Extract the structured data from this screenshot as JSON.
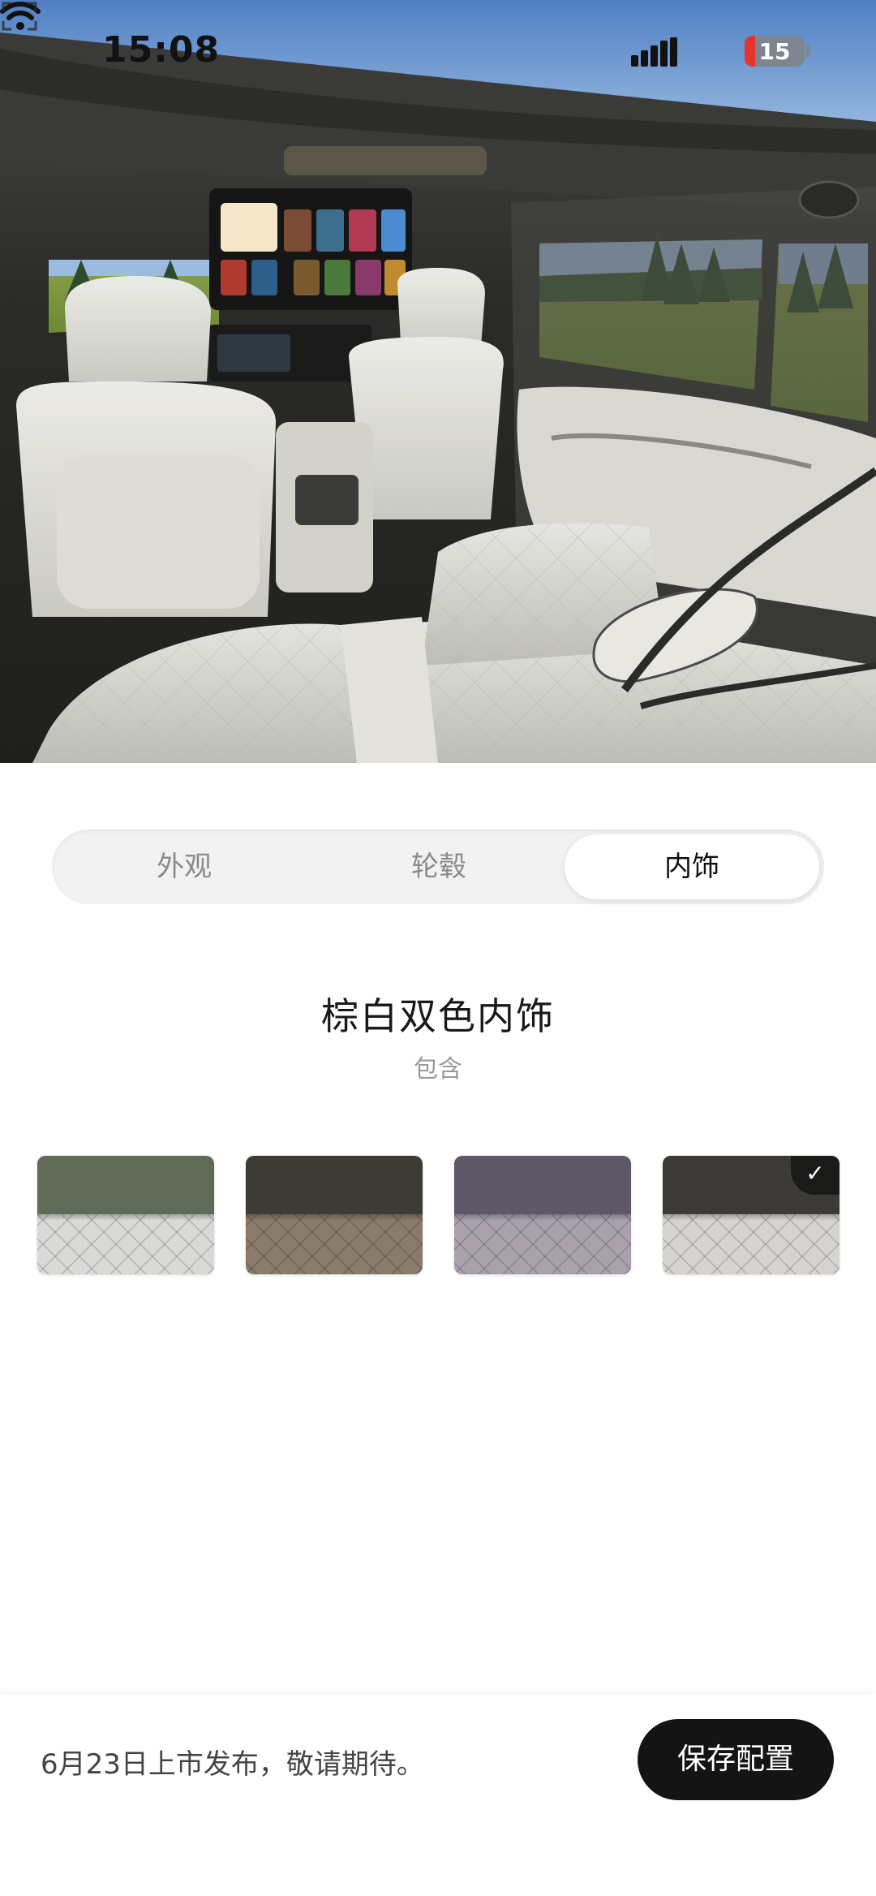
{
  "status_bar": {
    "time": "15:08",
    "battery": "15",
    "signal_icon": "cellular-signal-icon",
    "wifi_icon": "wifi-icon",
    "battery_color": "#e5342b"
  },
  "hero": {
    "image_subject": "car-interior-photo",
    "fullscreen_icon": "fullscreen-icon"
  },
  "tabs": [
    {
      "label": "外观",
      "active": false
    },
    {
      "label": "轮毂",
      "active": false
    },
    {
      "label": "内饰",
      "active": true
    }
  ],
  "config": {
    "title": "棕白双色内饰",
    "subtitle": "包含"
  },
  "swatches": [
    {
      "top_color": "#5f6a57",
      "bottom_color": "#d9d9d7",
      "selected": false
    },
    {
      "top_color": "#3c3b36",
      "bottom_color": "#8a7b6b",
      "selected": false
    },
    {
      "top_color": "#5e5766",
      "bottom_color": "#a9a1ad",
      "selected": false
    },
    {
      "top_color": "#3b3a36",
      "bottom_color": "#d6d4d0",
      "selected": true,
      "badge_icon": "checkmark-icon",
      "badge": "✓"
    }
  ],
  "footer": {
    "release_note": "6月23日上市发布，敬请期待。",
    "save_label": "保存配置",
    "accent": "#141414"
  }
}
